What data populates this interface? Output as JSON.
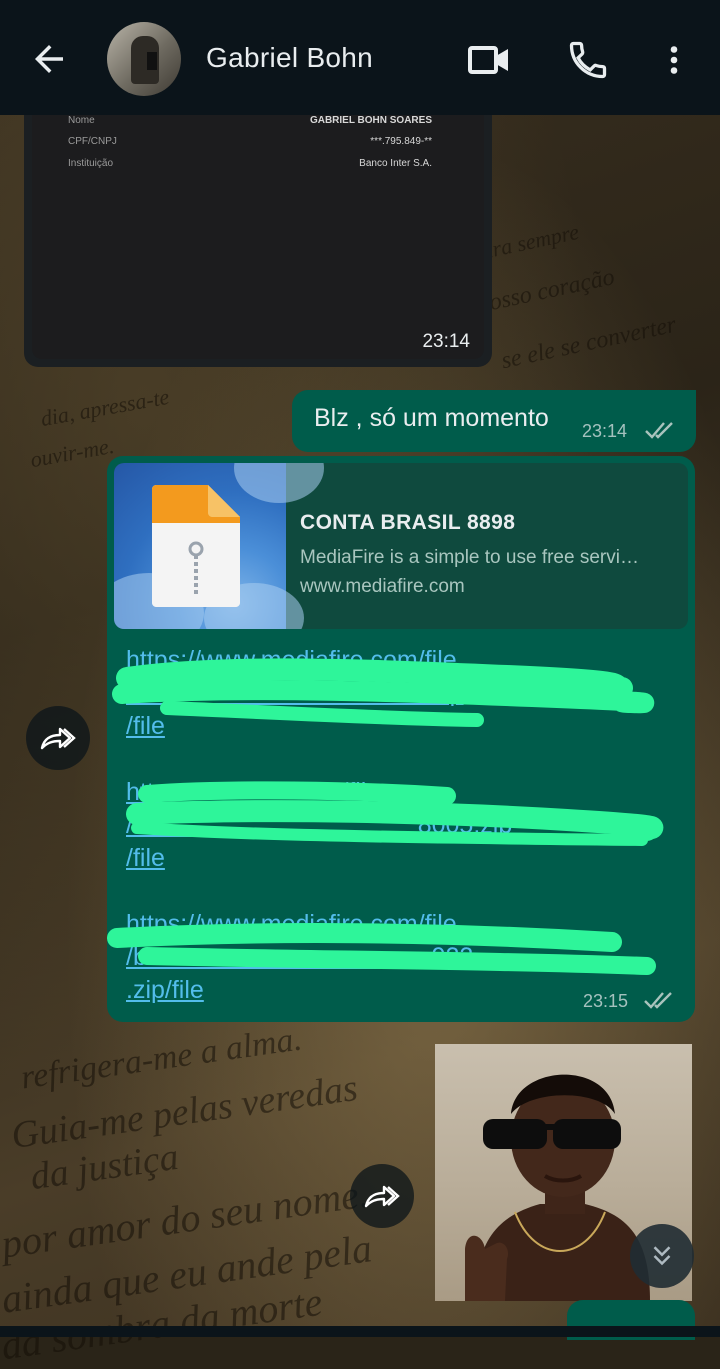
{
  "header": {
    "contact_name": "Gabriel Bohn",
    "icons": [
      "back-arrow-icon",
      "video-call-icon",
      "voice-call-icon",
      "more-options-icon"
    ]
  },
  "receipt": {
    "rows": [
      {
        "label": "Nome",
        "value": "GABRIEL BOHN SOARES"
      },
      {
        "label": "CPF/CNPJ",
        "value": "***.795.849-**"
      },
      {
        "label": "Instituição",
        "value": "Banco Inter S.A."
      }
    ],
    "time": "23:14"
  },
  "message1": {
    "text": "Blz , só um momento",
    "time": "23:14",
    "status": "read"
  },
  "message2": {
    "preview": {
      "title": "CONTA BRASIL 8898",
      "description": "MediaFire is a simple to use free servi…",
      "domain": "www.mediafire.com"
    },
    "links": [
      {
        "line1": "https://www.mediafire.com/file",
        "line2": "/                                        8.zip",
        "line3": "/file"
      },
      {
        "line1": "htt                           /file",
        "line2": "/                                         8005.zip",
        "line3": "/file"
      },
      {
        "line1": "https://www.mediafire.com/file",
        "line2": "/b                                         922",
        "line3": ".zip/file"
      }
    ],
    "time": "23:15",
    "status": "read"
  },
  "colors": {
    "outgoing_bubble": "#005c4b",
    "link": "#53bdeb",
    "redaction": "#2ef59a",
    "header": "#0b141a"
  }
}
